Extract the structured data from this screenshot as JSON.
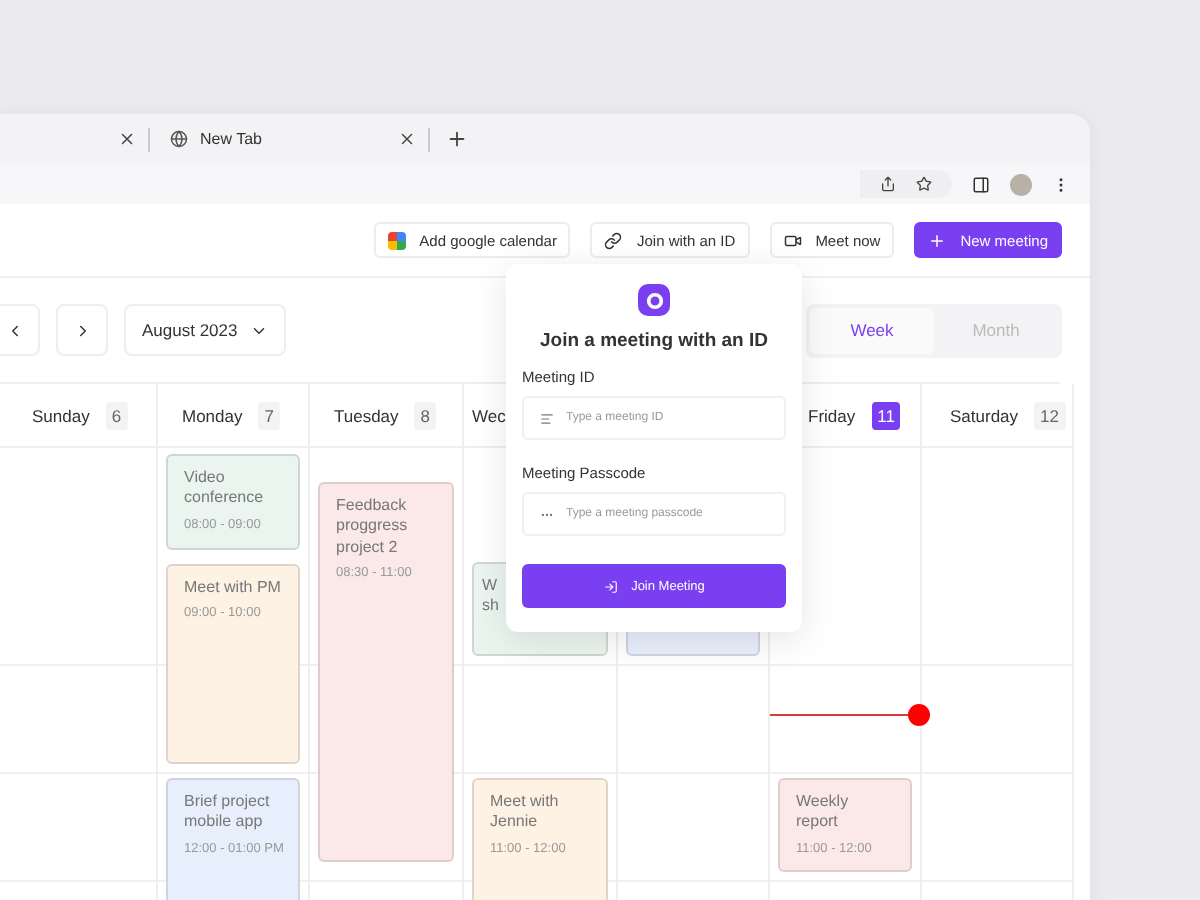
{
  "browser": {
    "tabs": [
      {
        "closable": true
      },
      {
        "label": "New Tab",
        "closable": true
      }
    ]
  },
  "toolbar": {
    "buttons": [
      {
        "kind": "google",
        "label": "Add google calendar"
      },
      {
        "kind": "link",
        "label": "Join with an ID"
      },
      {
        "kind": "meet",
        "label": "Meet now"
      },
      {
        "kind": "primary",
        "label": "New meeting"
      }
    ]
  },
  "nav": {
    "month": "August 2023"
  },
  "view_toggle": [
    {
      "label": "Week",
      "selected": true
    },
    {
      "label": "Month",
      "selected": false
    }
  ],
  "days": [
    {
      "name": "Sunday",
      "date": "6",
      "selected": false
    },
    {
      "name": "Monday",
      "date": "7",
      "selected": false,
      "events": [
        {
          "title": "Video conference",
          "time": "08:00 - 09:00",
          "color": "#eaf5f0"
        },
        {
          "title": "Meet with PM",
          "time": "09:00 - 10:00",
          "color": "#fdf2e4"
        },
        {
          "title": "Brief project mobile app",
          "time": "12:00 - 01:00 PM",
          "color": "#e8effc"
        }
      ]
    },
    {
      "name": "Tuesday",
      "date": "8",
      "selected": false,
      "events": [
        {
          "title": "Feedback proggress project 2",
          "time": "08:30 - 11:00",
          "color": "#fbe9e9"
        }
      ]
    },
    {
      "name": "Wec",
      "events": [
        {
          "title": "W sh",
          "color": "#eaf5f0"
        },
        {
          "title": "Meet with Jennie",
          "time": "11:00 - 12:00",
          "color": "#fdf2e4"
        }
      ]
    },
    {
      "events": [
        {
          "color": "#e8effc"
        }
      ]
    },
    {
      "name": "Friday",
      "date": "11",
      "selected": true,
      "now": true,
      "events": [
        {
          "title": "Weekly report",
          "time": "11:00 - 12:00",
          "color": "#fbe9e9"
        }
      ]
    },
    {
      "name": "Saturday",
      "date": "12",
      "selected": false
    }
  ],
  "join_dialog": {
    "title": "Join a meeting with an ID",
    "fields": [
      {
        "label": "Meeting ID",
        "placeholder": "Type a meeting ID",
        "kind": "id"
      },
      {
        "label": "Meeting Passcode",
        "placeholder": "Type a meeting passcode",
        "kind": "passcode"
      }
    ],
    "button": "Join Meeting"
  }
}
